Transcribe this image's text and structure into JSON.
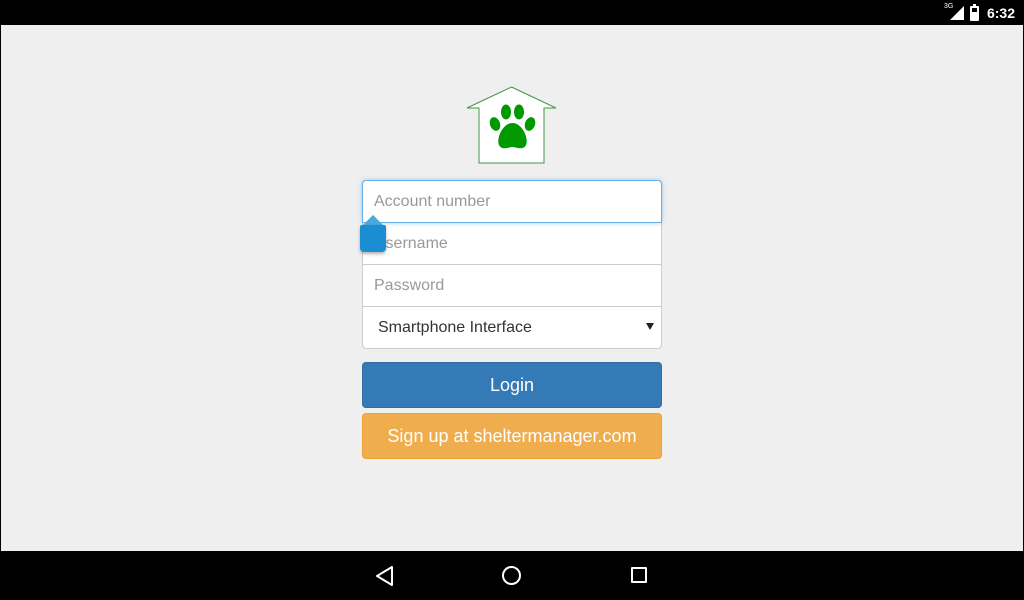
{
  "status_bar": {
    "network_label": "3G",
    "time": "6:32"
  },
  "logo": {
    "icon": "paw-house-logo",
    "colors": {
      "paw": "#009900",
      "outline": "#2e8b2e"
    }
  },
  "login_form": {
    "account_placeholder": "Account number",
    "username_placeholder": "Username",
    "password_placeholder": "Password",
    "interface_select": {
      "selected": "Smartphone Interface"
    }
  },
  "buttons": {
    "login_label": "Login",
    "signup_label": "Sign up at sheltermanager.com"
  },
  "nav_bar": {
    "icons": [
      "back-icon",
      "home-icon",
      "recent-apps-icon"
    ]
  },
  "colors": {
    "login_button": "#337ab7",
    "signup_button": "#f0ad4e",
    "background": "#efefef",
    "focus_border": "#66afe9"
  }
}
